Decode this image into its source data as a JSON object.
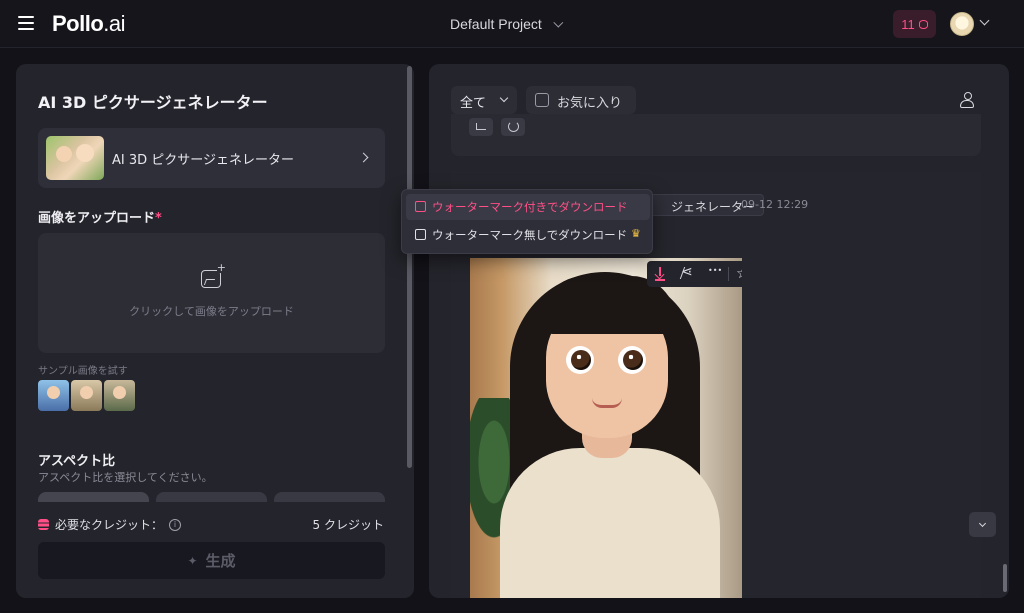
{
  "header": {
    "logo_main": "Pollo",
    "logo_suffix": ".ai",
    "project": "Default Project",
    "credits": "11"
  },
  "left": {
    "title": "AI 3D ピクサージェネレーター",
    "tool_card_name": "AI 3D ピクサージェネレーター",
    "upload_label": "画像をアップロード",
    "upload_required": "*",
    "upload_hint": "クリックして画像をアップロード",
    "sample_label": "サンプル画像を試す",
    "aspect_title": "アスペクト比",
    "aspect_sub": "アスペクト比を選択してください。",
    "credits_required_label": "必要なクレジット：",
    "credits_required_value": "5 クレジット",
    "generate_label": "生成"
  },
  "right": {
    "filter_value": "全て",
    "favorites_label": "お気に入り",
    "tool_tag": "ジェネレーター",
    "timestamp": "09-12 12:29"
  },
  "dropdown": {
    "item_watermark": "ウォーターマーク付きでダウンロード",
    "item_no_watermark": "ウォーターマーク無しでダウンロード"
  },
  "colors": {
    "accent": "#ff4f86",
    "panel": "#24242c",
    "background": "#121218"
  }
}
